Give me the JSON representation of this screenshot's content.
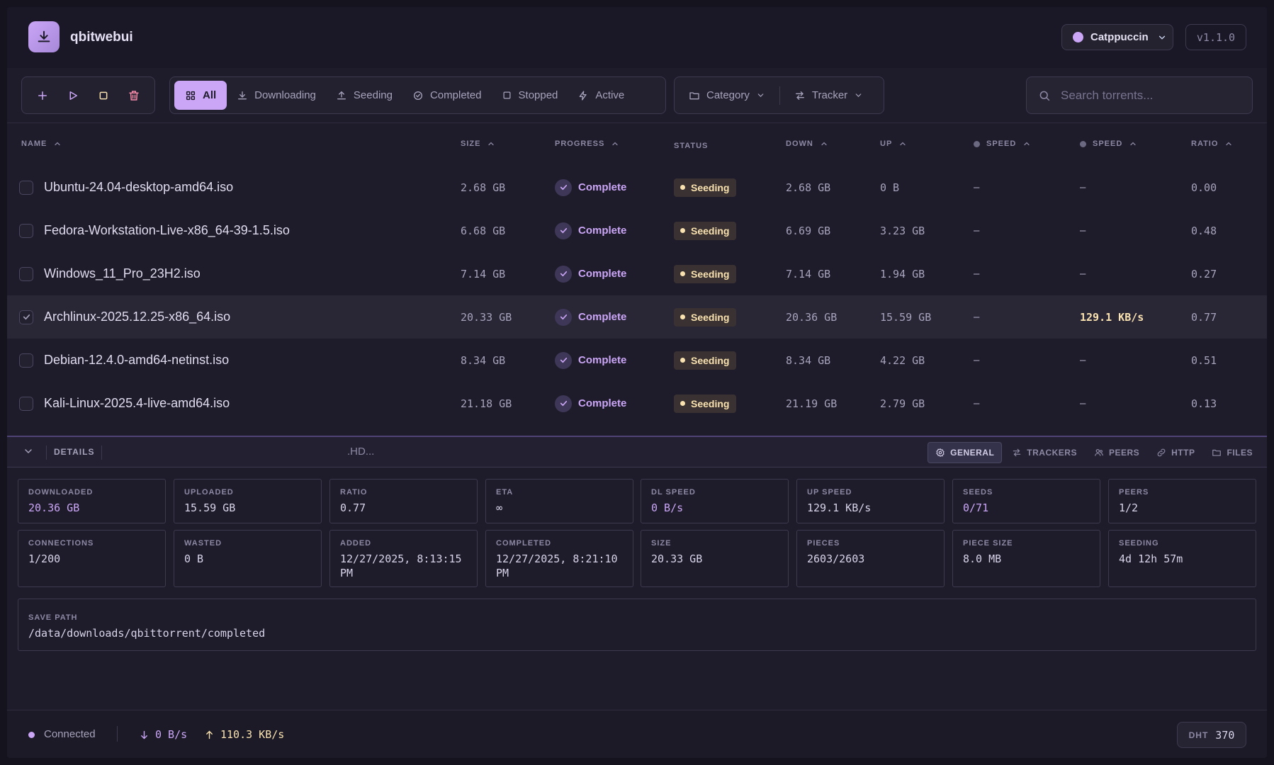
{
  "header": {
    "app_title": "qbitwebui",
    "theme_label": "Catppuccin",
    "version": "v1.1.0"
  },
  "toolbar": {
    "filters": [
      {
        "label": "All",
        "icon": "grid-icon",
        "active": true
      },
      {
        "label": "Downloading",
        "icon": "download-icon"
      },
      {
        "label": "Seeding",
        "icon": "upload-icon"
      },
      {
        "label": "Completed",
        "icon": "check-circle-icon"
      },
      {
        "label": "Stopped",
        "icon": "stop-icon"
      },
      {
        "label": "Active",
        "icon": "bolt-icon"
      }
    ],
    "category_label": "Category",
    "tracker_label": "Tracker",
    "search_placeholder": "Search torrents..."
  },
  "table": {
    "columns": {
      "name": "NAME",
      "size": "SIZE",
      "progress": "PROGRESS",
      "status": "STATUS",
      "down": "DOWN",
      "up": "UP",
      "dl_speed": "SPEED",
      "up_speed": "SPEED",
      "ratio": "RATIO"
    },
    "rows": [
      {
        "name": "Ubuntu-24.04-desktop-amd64.iso",
        "size": "2.68 GB",
        "progress": "Complete",
        "status": "Seeding",
        "down": "2.68 GB",
        "up": "0 B",
        "dl_speed": "–",
        "up_speed": "–",
        "ratio": "0.00",
        "checked": false
      },
      {
        "name": "Fedora-Workstation-Live-x86_64-39-1.5.iso",
        "size": "6.68 GB",
        "progress": "Complete",
        "status": "Seeding",
        "down": "6.69 GB",
        "up": "3.23 GB",
        "dl_speed": "–",
        "up_speed": "–",
        "ratio": "0.48",
        "checked": false
      },
      {
        "name": "Windows_11_Pro_23H2.iso",
        "size": "7.14 GB",
        "progress": "Complete",
        "status": "Seeding",
        "down": "7.14 GB",
        "up": "1.94 GB",
        "dl_speed": "–",
        "up_speed": "–",
        "ratio": "0.27",
        "checked": false
      },
      {
        "name": "Archlinux-2025.12.25-x86_64.iso",
        "size": "20.33 GB",
        "progress": "Complete",
        "status": "Seeding",
        "down": "20.36 GB",
        "up": "15.59 GB",
        "dl_speed": "–",
        "up_speed": "129.1 KB/s",
        "ratio": "0.77",
        "checked": true
      },
      {
        "name": "Debian-12.4.0-amd64-netinst.iso",
        "size": "8.34 GB",
        "progress": "Complete",
        "status": "Seeding",
        "down": "8.34 GB",
        "up": "4.22 GB",
        "dl_speed": "–",
        "up_speed": "–",
        "ratio": "0.51",
        "checked": false
      },
      {
        "name": "Kali-Linux-2025.4-live-amd64.iso",
        "size": "21.18 GB",
        "progress": "Complete",
        "status": "Seeding",
        "down": "21.19 GB",
        "up": "2.79 GB",
        "dl_speed": "–",
        "up_speed": "–",
        "ratio": "0.13",
        "checked": false
      }
    ]
  },
  "details": {
    "label": "DETAILS",
    "name_fragment": ".HD...",
    "tabs": [
      {
        "label": "GENERAL",
        "icon": "gear-icon",
        "active": true
      },
      {
        "label": "TRACKERS",
        "icon": "swap-icon"
      },
      {
        "label": "PEERS",
        "icon": "users-icon"
      },
      {
        "label": "HTTP",
        "icon": "link-icon"
      },
      {
        "label": "FILES",
        "icon": "folder-icon"
      }
    ],
    "stats_row1": [
      {
        "label": "DOWNLOADED",
        "value": "20.36 GB",
        "accent": true
      },
      {
        "label": "UPLOADED",
        "value": "15.59 GB"
      },
      {
        "label": "RATIO",
        "value": "0.77"
      },
      {
        "label": "ETA",
        "value": "∞"
      },
      {
        "label": "DL SPEED",
        "value": "0 B/s",
        "accent": true
      },
      {
        "label": "UP SPEED",
        "value": "129.1 KB/s"
      },
      {
        "label": "SEEDS",
        "value": "0/71",
        "accent": true
      },
      {
        "label": "PEERS",
        "value": "1/2"
      }
    ],
    "stats_row2": [
      {
        "label": "CONNECTIONS",
        "value": "1/200"
      },
      {
        "label": "WASTED",
        "value": "0 B"
      },
      {
        "label": "ADDED",
        "value": "12/27/2025, 8:13:15 PM"
      },
      {
        "label": "COMPLETED",
        "value": "12/27/2025, 8:21:10 PM"
      },
      {
        "label": "SIZE",
        "value": "20.33 GB"
      },
      {
        "label": "PIECES",
        "value": "2603/2603"
      },
      {
        "label": "PIECE SIZE",
        "value": "8.0 MB"
      },
      {
        "label": "SEEDING",
        "value": "4d 12h 57m"
      }
    ],
    "save_path_label": "SAVE PATH",
    "save_path": "/data/downloads/qbittorrent/completed"
  },
  "statusbar": {
    "connection": "Connected",
    "down_speed": "0 B/s",
    "up_speed": "110.3 KB/s",
    "dht_label": "DHT",
    "dht_value": "370"
  }
}
